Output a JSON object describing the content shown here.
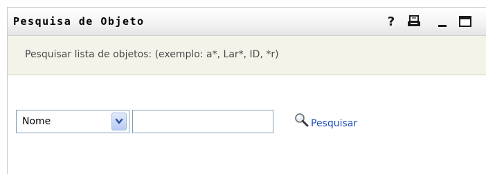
{
  "portlet": {
    "title": "Pesquisa de Objeto",
    "help_label": "?",
    "description": "Pesquisar lista de objetos: (exemplo: a*, Lar*, ID, *r)"
  },
  "search": {
    "field_selected": "Nome",
    "query_value": "",
    "query_placeholder": "",
    "button_label": "Pesquisar"
  },
  "icons": {
    "help": "help-icon",
    "print": "print-icon",
    "minimize": "minimize-icon",
    "maximize": "maximize-icon",
    "dropdown": "chevron-down-icon",
    "search": "magnifier-icon"
  },
  "colors": {
    "link": "#1f51b8",
    "description_band": "#f4f3ea",
    "input_border": "#7f9db9",
    "dropdown_button": "#b8cdf2"
  }
}
